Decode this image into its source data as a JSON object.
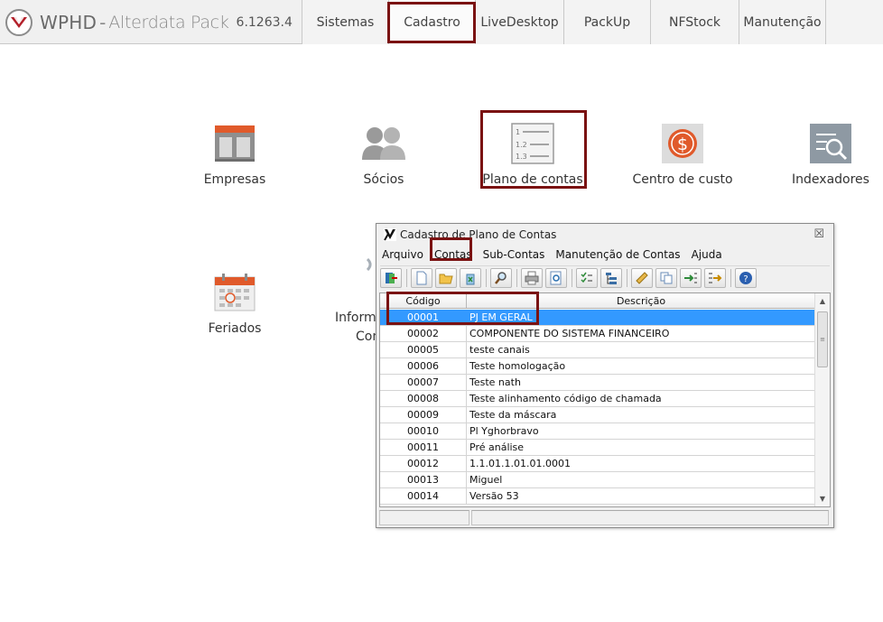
{
  "brand": {
    "name": "WPHD",
    "separator": "-",
    "product": "Alterdata Pack",
    "version": "6.1263.4"
  },
  "nav": [
    "Sistemas",
    "Cadastro",
    "LiveDesktop",
    "PackUp",
    "NFStock",
    "Manutenção"
  ],
  "nav_active": "Cadastro",
  "tiles": {
    "empresas": "Empresas",
    "socios": "Sócios",
    "plano": "Plano de contas",
    "centro": "Centro de custo",
    "indexadores": "Indexadores",
    "feriados": "Feriados",
    "informacoes_1": "Inform",
    "informacoes_2": "Con"
  },
  "dialog": {
    "title": "Cadastro de Plano de Contas",
    "close": "☒",
    "menu": [
      "Arquivo",
      "Contas",
      "Sub-Contas",
      "Manutenção de Contas",
      "Ajuda"
    ],
    "columns": [
      "Código",
      "Descrição"
    ],
    "rows": [
      {
        "codigo": "00001",
        "descricao": "PJ EM GERAL"
      },
      {
        "codigo": "00002",
        "descricao": "COMPONENTE DO SISTEMA FINANCEIRO"
      },
      {
        "codigo": "00005",
        "descricao": "teste canais"
      },
      {
        "codigo": "00006",
        "descricao": "Teste homologação"
      },
      {
        "codigo": "00007",
        "descricao": "Teste nath"
      },
      {
        "codigo": "00008",
        "descricao": "Teste alinhamento código de chamada"
      },
      {
        "codigo": "00009",
        "descricao": "Teste da máscara"
      },
      {
        "codigo": "00010",
        "descricao": "Pl Yghorbravo"
      },
      {
        "codigo": "00011",
        "descricao": "Pré análise"
      },
      {
        "codigo": "00012",
        "descricao": "1.1.01.1.01.01.0001"
      },
      {
        "codigo": "00013",
        "descricao": "Miguel"
      },
      {
        "codigo": "00014",
        "descricao": "Versão 53"
      }
    ],
    "selected_row": "00001"
  },
  "colors": {
    "highlight": "#7a1212",
    "selection": "#3399ff",
    "accent_orange": "#e05a2b"
  }
}
